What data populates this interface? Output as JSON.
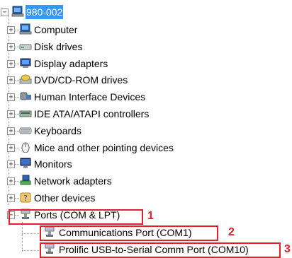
{
  "root": {
    "label": "980-002",
    "icon": "computer-icon",
    "expanded": true
  },
  "items": [
    {
      "label": "Computer",
      "icon": "computer-icon",
      "expanded": false
    },
    {
      "label": "Disk drives",
      "icon": "disk-drive-icon",
      "expanded": false
    },
    {
      "label": "Display adapters",
      "icon": "display-adapter-icon",
      "expanded": false
    },
    {
      "label": "DVD/CD-ROM drives",
      "icon": "dvd-drive-icon",
      "expanded": false
    },
    {
      "label": "Human Interface Devices",
      "icon": "hid-icon",
      "expanded": false
    },
    {
      "label": "IDE ATA/ATAPI controllers",
      "icon": "ide-controller-icon",
      "expanded": false
    },
    {
      "label": "Keyboards",
      "icon": "keyboard-icon",
      "expanded": false
    },
    {
      "label": "Mice and other pointing devices",
      "icon": "mouse-icon",
      "expanded": false
    },
    {
      "label": "Monitors",
      "icon": "monitor-icon",
      "expanded": false
    },
    {
      "label": "Network adapters",
      "icon": "network-adapter-icon",
      "expanded": false
    },
    {
      "label": "Other devices",
      "icon": "unknown-device-icon",
      "expanded": false
    },
    {
      "label": "Ports (COM & LPT)",
      "icon": "port-icon",
      "expanded": true
    }
  ],
  "ports_children": [
    {
      "label": "Communications Port (COM1)",
      "icon": "port-icon"
    },
    {
      "label": "Prolific USB-to-Serial Comm Port (COM10)",
      "icon": "port-icon"
    }
  ],
  "callouts": [
    "1",
    "2",
    "3"
  ],
  "colors": {
    "selection": "#3399ff",
    "annotation": "#e0202a",
    "tree_lines": "#a0a0a0"
  }
}
